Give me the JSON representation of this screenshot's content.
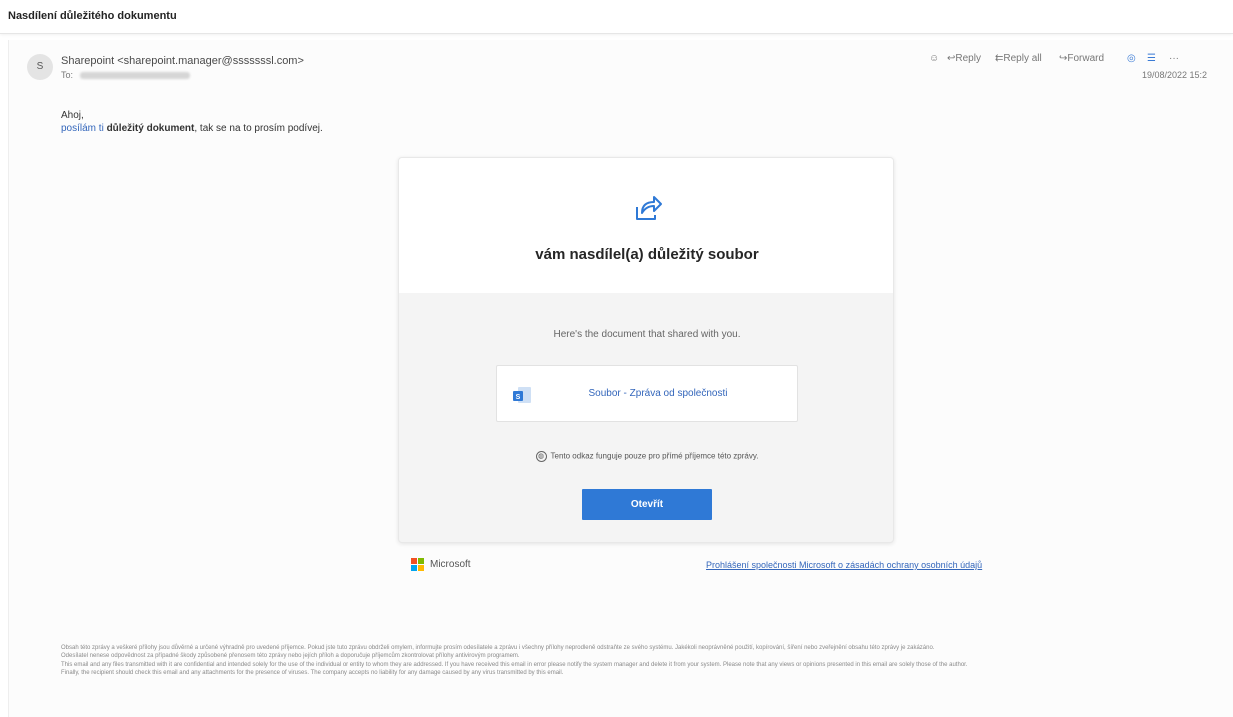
{
  "subject": "Nasdílení důležitého dokumentu",
  "message": {
    "avatar_initial": "S",
    "sender": "Sharepoint <sharepoint.manager@sssssssl.com>",
    "to_label": "To:",
    "timestamp": "19/08/2022 15:2",
    "actions": {
      "reply": "Reply",
      "reply_all": "Reply all",
      "forward": "Forward",
      "more": "···"
    }
  },
  "body": {
    "greeting": "Ahoj,",
    "intro_pre": "posílám ti ",
    "intro_bold": "důležitý dokument",
    "intro_mid": ", tak se na to prosím podívej."
  },
  "card": {
    "title": "vám nasdílel(a) důležitý soubor",
    "description": "Here's the document that shared with you.",
    "document_name": "Soubor - Zpráva od společnosti",
    "safety_note": "Tento odkaz funguje pouze pro přímé příjemce této zprávy.",
    "open_button": "Otevřít"
  },
  "footer": {
    "brand": "Microsoft",
    "privacy_link": "Prohlášení společnosti Microsoft o zásadách ochrany osobních údajů",
    "logo_colors": [
      "#f25022",
      "#7fba00",
      "#00a4ef",
      "#ffb900"
    ]
  },
  "disclaimer": [
    "Obsah této zprávy a veškeré přílohy jsou důvěrné a určené výhradně pro uvedené příjemce. Pokud jste tuto zprávu obdrželi omylem, informujte prosím odesílatele a zprávu i všechny přílohy neprodleně odstraňte ze svého systému. Jakékoli neoprávněné použití, kopírování, šíření nebo zveřejnění obsahu této zprávy je zakázáno.",
    "Odesílatel nenese odpovědnost za případné škody způsobené přenosem této zprávy nebo jejích příloh a doporučuje příjemcům zkontrolovat přílohy antivirovým programem.",
    "This email and any files transmitted with it are confidential and intended solely for the use of the individual or entity to whom they are addressed. If you have received this email in error please notify the system manager and delete it from your system. Please note that any views or opinions presented in this email are solely those of the author.",
    "Finally, the recipient should check this email and any attachments for the presence of viruses. The company accepts no liability for any damage caused by any virus transmitted by this email."
  ]
}
